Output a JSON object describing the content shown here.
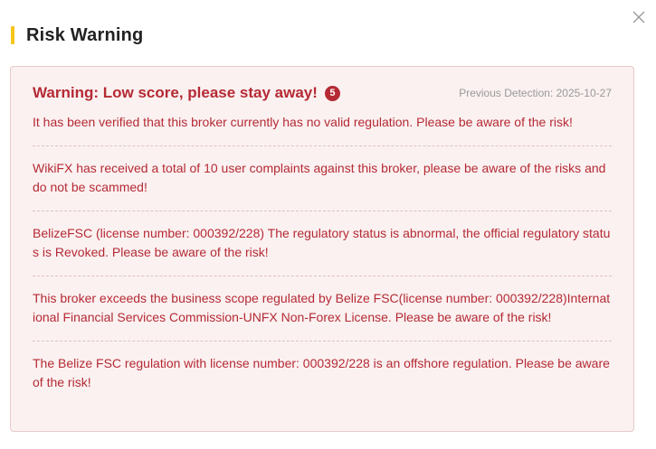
{
  "header": {
    "title": "Risk Warning",
    "accent_color": "#f5c518"
  },
  "close_icon": "close-icon",
  "warning": {
    "title": "Warning: Low score, please stay away!",
    "count": "5",
    "detection_label": "Previous Detection:",
    "detection_date": "2025-10-27",
    "text_color": "#b52a34",
    "items": [
      "It has been verified that this broker currently has no valid regulation. Please be aware of the risk!",
      "WikiFX has received a total of 10 user complaints against this broker, please be aware of the risks and do not be scammed!",
      "BelizeFSC (license number: 000392/228) The regulatory status is abnormal, the official regulatory status is Revoked. Please be aware of the risk!",
      "This broker exceeds the business scope regulated by Belize FSC(license number: 000392/228)International Financial Services Commission-UNFX Non-Forex License. Please be aware of the risk!",
      "The Belize FSC regulation with license number: 000392/228 is an offshore regulation. Please be aware of the risk!"
    ]
  }
}
